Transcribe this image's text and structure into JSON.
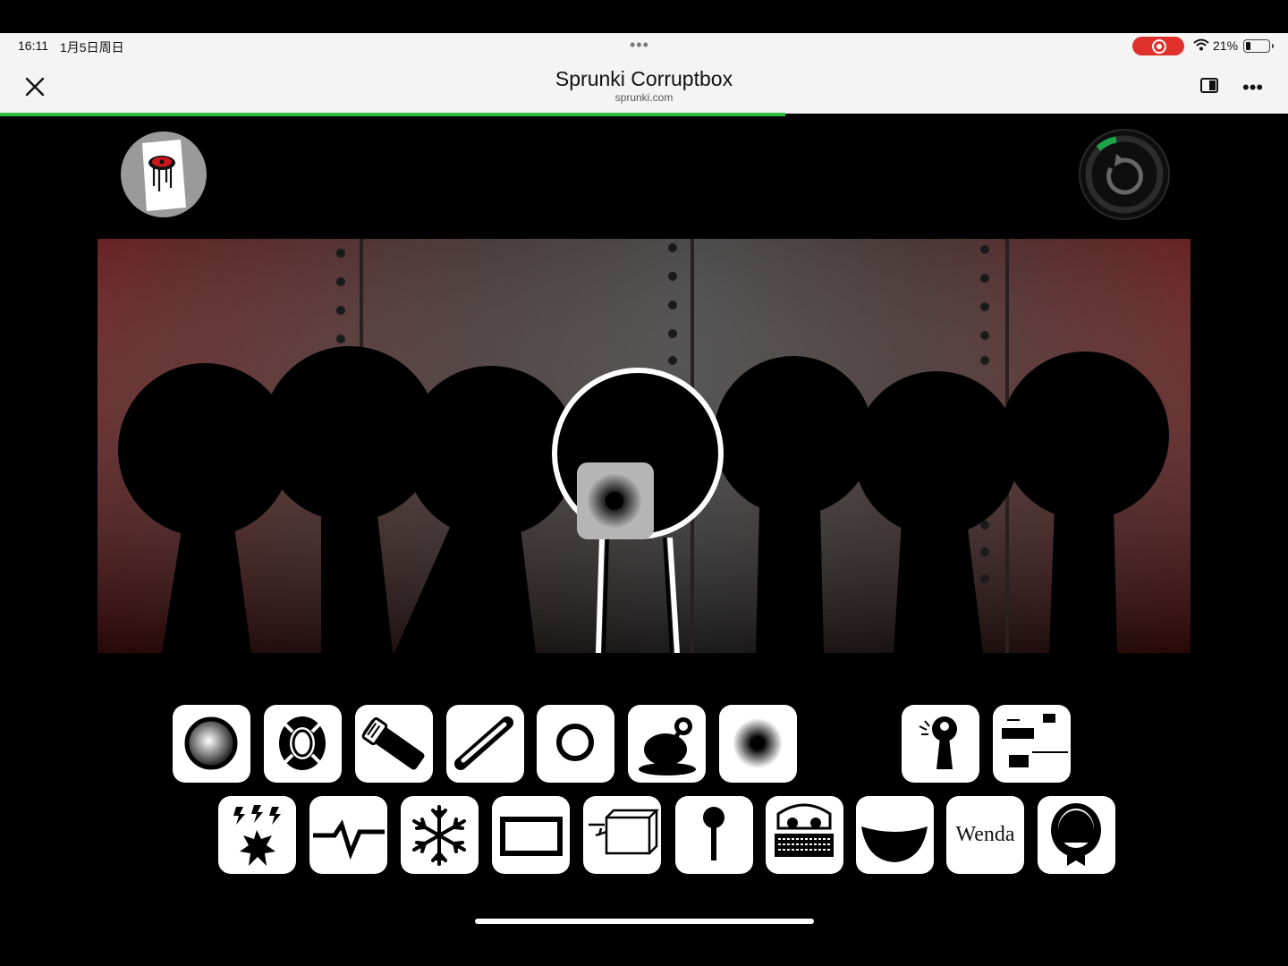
{
  "status_bar": {
    "time": "16:11",
    "date": "1月5日周日",
    "battery": "21%"
  },
  "browser": {
    "title": "Sprunki Corruptbox",
    "domain": "sprunki.com",
    "load_progress_pct": 61,
    "accent": "#2fbf3f"
  },
  "stage": {
    "active_slot": 4
  },
  "palette": {
    "row1": [
      "sphere-icon",
      "lifebuoy-icon",
      "flashlight-icon",
      "stick-icon",
      "ring-icon",
      "blob-icon",
      "hole-icon"
    ],
    "row1b": [
      "keyhole-icon",
      "bars-icon"
    ],
    "row2": [
      "lightning-burst-icon",
      "pulse-icon",
      "snowflake-icon",
      "frame-icon",
      "box-icon",
      "pin-icon",
      "skull-face-icon",
      "smile-icon",
      "wenda-text",
      "head-icon"
    ],
    "wenda_label": "Wenda"
  }
}
